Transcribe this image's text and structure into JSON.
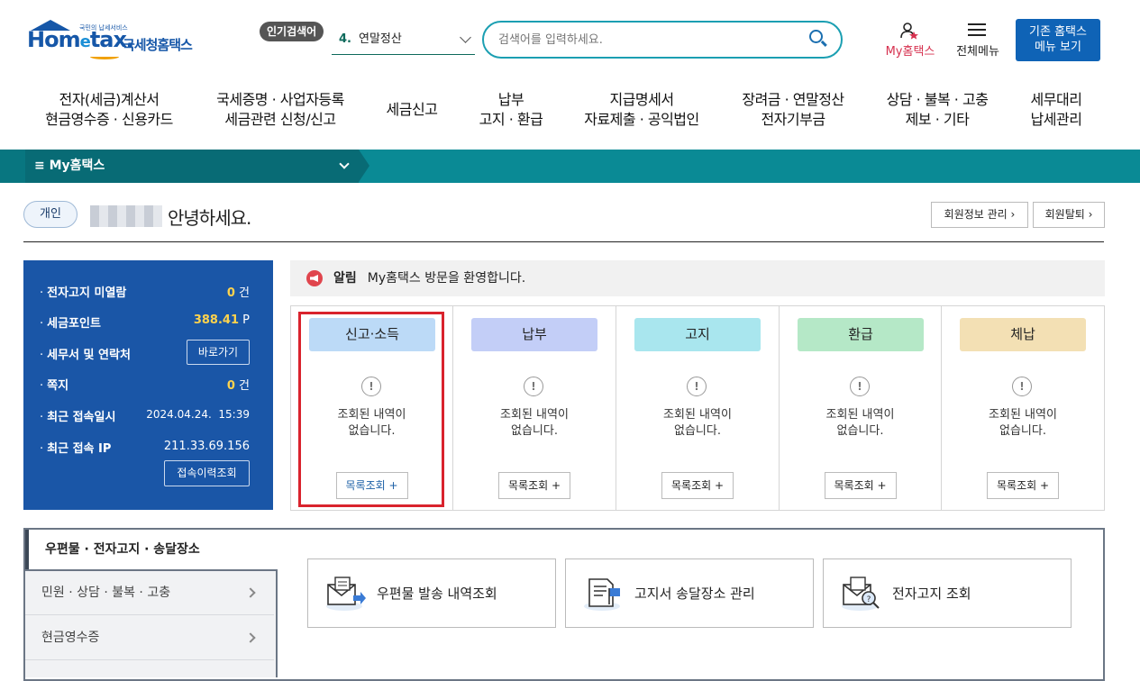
{
  "header": {
    "logo": {
      "home": "Hom",
      "e": "e",
      "tax": "tax.",
      "small": "국민의 납세서비스",
      "kor": "국세청홈택스"
    },
    "popular_label": "인기검색어",
    "popular_keyword": {
      "num": "4.",
      "text": "연말정산"
    },
    "search": {
      "placeholder": "검색어를 입력하세요."
    },
    "my_hometax": "My홈택스",
    "all_menu": "전체메뉴",
    "old_menu": [
      "기존 홈택스",
      "메뉴 보기"
    ]
  },
  "gnb": [
    {
      "line1": "전자(세금)계산서",
      "line2": "현금영수증 · 신용카드"
    },
    {
      "line1": "국세증명 · 사업자등록",
      "line2": "세금관련 신청/신고"
    },
    {
      "line1": "세금신고",
      "line2": ""
    },
    {
      "line1": "납부",
      "line2": "고지 · 환급"
    },
    {
      "line1": "지급명세서",
      "line2": "자료제출 · 공익법인"
    },
    {
      "line1": "장려금 · 연말정산",
      "line2": "전자기부금"
    },
    {
      "line1": "상담 · 불복 · 고충",
      "line2": "제보 · 기타"
    },
    {
      "line1": "세무대리",
      "line2": "납세관리"
    }
  ],
  "band": {
    "title": "≡  My홈택스"
  },
  "greeting": {
    "type": "개인",
    "text": "안녕하세요.",
    "member_info": "회원정보 관리 ›",
    "withdraw": "회원탈퇴 ›"
  },
  "panel": {
    "rows": [
      {
        "label": "전자고지 미열람",
        "value": "0",
        "unit": "건"
      },
      {
        "label": "세금포인트",
        "value": "388.41",
        "unit": "P"
      },
      {
        "label": "세무서 및 연락처",
        "button": "바로가기"
      },
      {
        "label": "쪽지",
        "value": "0",
        "unit": "건"
      },
      {
        "label": "최근 접속일시",
        "value": "2024.04.24.  15:39"
      },
      {
        "label": "최근 접속 IP",
        "value": "211.33.69.156"
      }
    ],
    "history_button": "접속이력조회"
  },
  "notice": {
    "label": "알림",
    "text": "My홈택스 방문을 환영합니다."
  },
  "cards": [
    {
      "title": "신고·소득",
      "color": "#bcdaf7",
      "msg1": "조회된 내역이",
      "msg2": "없습니다.",
      "button": "목록조회 +"
    },
    {
      "title": "납부",
      "color": "#c3cef7",
      "msg1": "조회된 내역이",
      "msg2": "없습니다.",
      "button": "목록조회 +"
    },
    {
      "title": "고지",
      "color": "#a9e6ee",
      "msg1": "조회된 내역이",
      "msg2": "없습니다.",
      "button": "목록조회 +"
    },
    {
      "title": "환급",
      "color": "#b5e8c7",
      "msg1": "조회된 내역이",
      "msg2": "없습니다.",
      "button": "목록조회 +"
    },
    {
      "title": "체납",
      "color": "#f3e0b4",
      "msg1": "조회된 내역이",
      "msg2": "없습니다.",
      "button": "목록조회 +"
    }
  ],
  "bottom": {
    "title": "우편물 · 전자고지 · 송달장소",
    "side": [
      "민원 · 상담 · 불복 · 고충",
      "현금영수증"
    ],
    "quick": [
      "우편물 발송 내역조회",
      "고지서 송달장소 관리",
      "전자고지 조회"
    ]
  }
}
